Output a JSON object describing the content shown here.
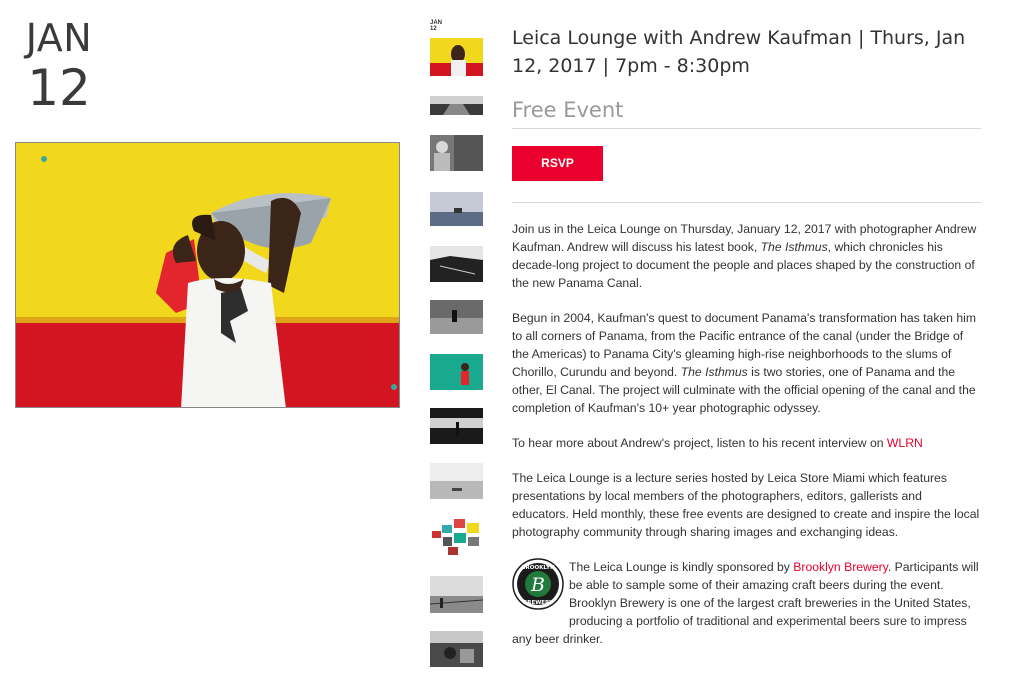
{
  "date": {
    "month": "JAN",
    "day": "12"
  },
  "thumbnails": {
    "first_date_month": "JAN",
    "first_date_day": "12"
  },
  "event": {
    "title": "Leica Lounge with Andrew Kaufman | Thurs, Jan 12, 2017 | 7pm - 8:30pm",
    "price": "Free Event",
    "rsvp_label": "RSVP"
  },
  "description": {
    "p1_a": "Join us in the Leica Lounge on Thursday, January 12, 2017 with photographer Andrew Kaufman. Andrew will discuss his latest book, ",
    "p1_em": "The Isthmus",
    "p1_b": ", which chronicles his decade-long project to document the people and places shaped by the construction of the new Panama Canal.",
    "p2_a": "Begun in 2004, Kaufman's quest to document Panama's transformation has taken him to all corners of Panama, from the Pacific entrance of the canal (under the Bridge of the Americas) to Panama City's gleaming high-rise neighborhoods to the slums of Chorillo, Curundu and beyond. ",
    "p2_em": "The Isthmus",
    "p2_b": " is two stories, one of Panama and the other, El Canal. The project will culminate with the official opening of the canal and the completion of Kaufman's 10+ year photographic odyssey.",
    "p3_a": "To hear more about Andrew's project, listen to his recent interview on ",
    "p3_link": "WLRN",
    "p4": "The Leica Lounge is a lecture series hosted by Leica Store Miami which features presentations by local members of the photographers, editors, gallerists and educators. Held monthly, these free events are designed to create and inspire the local photography community through sharing images and exchanging ideas.",
    "sponsor_a": "The Leica Lounge is kindly sponsored by ",
    "sponsor_link": "Brooklyn Brewery",
    "sponsor_b": ". Participants will be able to sample some of their amazing craft beers during the event. Brooklyn Brewery is one of the largest craft breweries in the United States, producing a portfolio of traditional and experimental beers sure to impress any beer drinker."
  },
  "sponsor_logo": {
    "text_top": "BROOKLYN",
    "text_bottom": "BREWERY",
    "letter": "B"
  },
  "colors": {
    "accent": "#e9002d",
    "price_gray": "#999999",
    "rule": "#d8d8d8"
  }
}
